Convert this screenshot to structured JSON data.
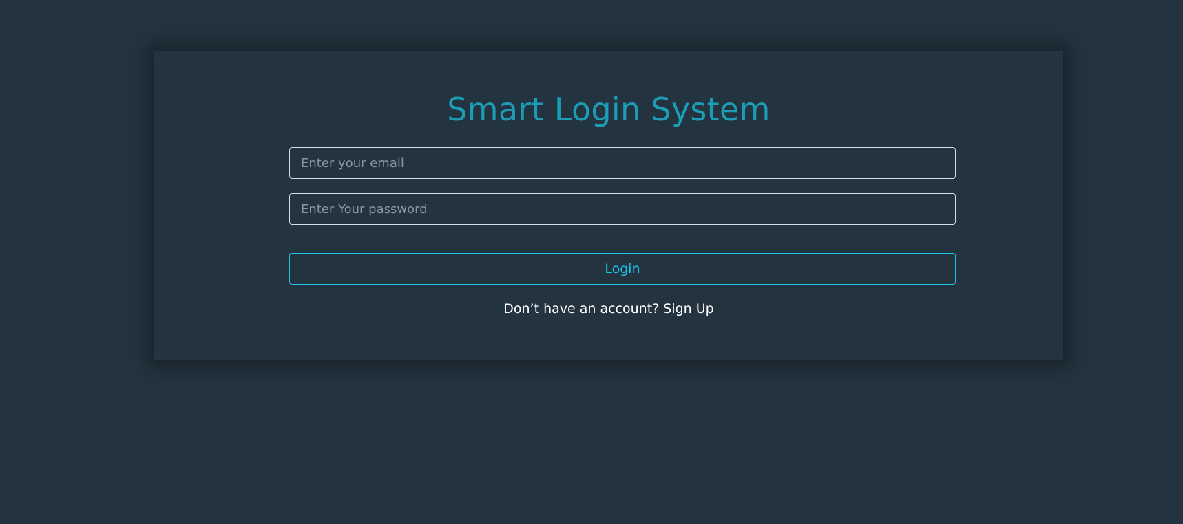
{
  "login": {
    "title": "Smart Login System",
    "email_placeholder": "Enter your email",
    "password_placeholder": "Enter Your password",
    "button_label": "Login",
    "signup_prompt": "Don’t have an account? ",
    "signup_link": "Sign Up"
  },
  "colors": {
    "background": "#23333f",
    "title": "#1c9db5",
    "button_accent": "#1ec3e9",
    "text": "#ffffff"
  }
}
